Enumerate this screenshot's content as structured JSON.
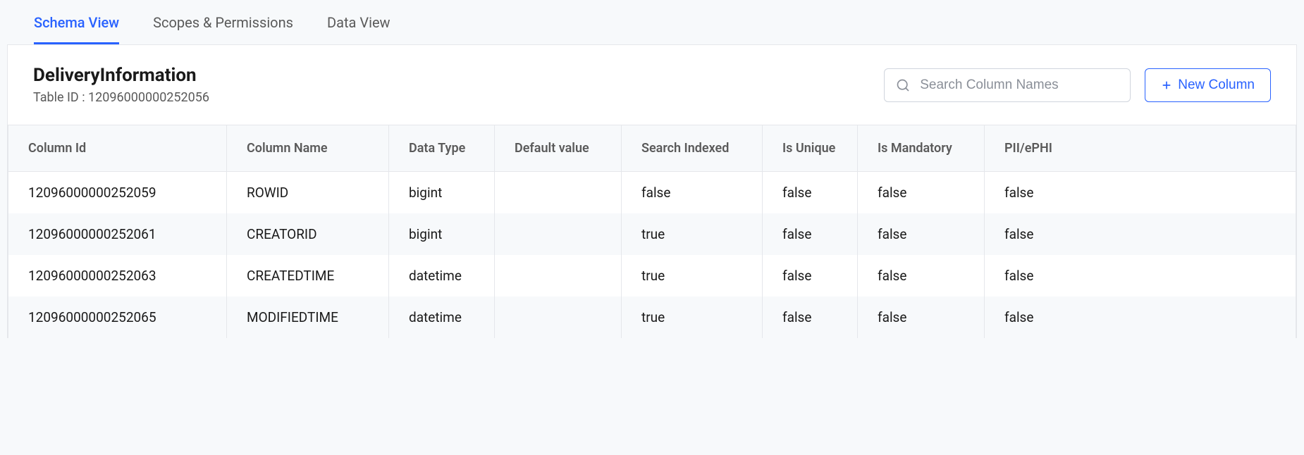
{
  "tabs": [
    {
      "label": "Schema View",
      "active": true
    },
    {
      "label": "Scopes & Permissions",
      "active": false
    },
    {
      "label": "Data View",
      "active": false
    }
  ],
  "header": {
    "table_name": "DeliveryInformation",
    "table_id_label": "Table ID : 12096000000252056"
  },
  "search": {
    "placeholder": "Search Column Names"
  },
  "new_column_button": {
    "label": "New Column"
  },
  "columns": {
    "headers": [
      "Column Id",
      "Column Name",
      "Data Type",
      "Default value",
      "Search Indexed",
      "Is Unique",
      "Is Mandatory",
      "PII/ePHI"
    ],
    "rows": [
      {
        "id": "12096000000252059",
        "name": "ROWID",
        "type": "bigint",
        "default": "",
        "search_indexed": "false",
        "is_unique": "false",
        "is_mandatory": "false",
        "pii": "false"
      },
      {
        "id": "12096000000252061",
        "name": "CREATORID",
        "type": "bigint",
        "default": "",
        "search_indexed": "true",
        "is_unique": "false",
        "is_mandatory": "false",
        "pii": "false"
      },
      {
        "id": "12096000000252063",
        "name": "CREATEDTIME",
        "type": "datetime",
        "default": "",
        "search_indexed": "true",
        "is_unique": "false",
        "is_mandatory": "false",
        "pii": "false"
      },
      {
        "id": "12096000000252065",
        "name": "MODIFIEDTIME",
        "type": "datetime",
        "default": "",
        "search_indexed": "true",
        "is_unique": "false",
        "is_mandatory": "false",
        "pii": "false"
      }
    ]
  }
}
